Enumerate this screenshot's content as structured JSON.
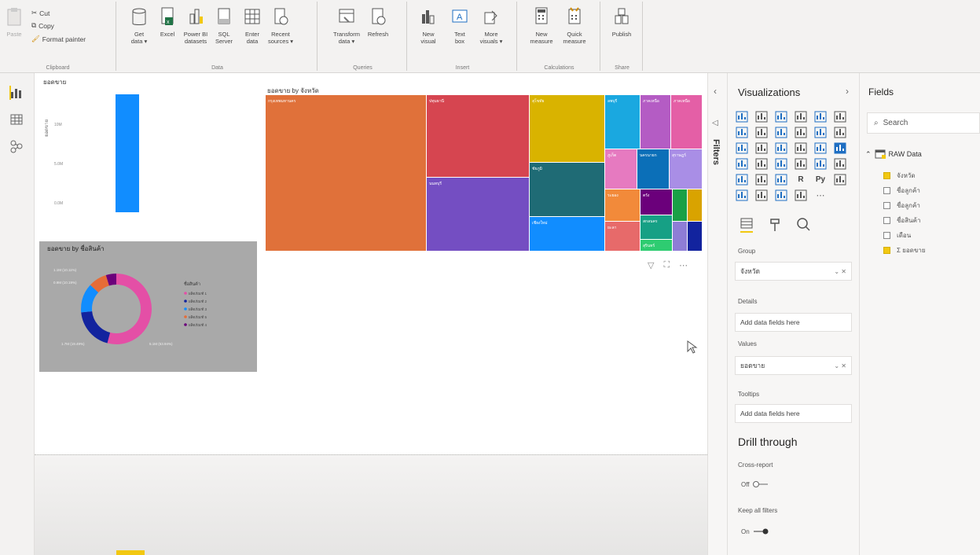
{
  "ribbon": {
    "clipboard": {
      "paste": "Paste",
      "cut": "Cut",
      "copy": "Copy",
      "format_painter": "Format painter",
      "group": "Clipboard"
    },
    "data": {
      "get_data": "Get\ndata ▾",
      "excel": "Excel",
      "power_bi": "Power BI\ndatasets",
      "sql": "SQL\nServer",
      "enter_data": "Enter\ndata",
      "recent": "Recent\nsources ▾",
      "group": "Data"
    },
    "queries": {
      "transform": "Transform\ndata ▾",
      "refresh": "Refresh",
      "group": "Queries"
    },
    "insert": {
      "new_visual": "New\nvisual",
      "text_box": "Text\nbox",
      "more_visuals": "More\nvisuals ▾",
      "group": "Insert"
    },
    "calculations": {
      "new_measure": "New\nmeasure",
      "quick_measure": "Quick\nmeasure",
      "group": "Calculations"
    },
    "share": {
      "publish": "Publish",
      "group": "Share"
    }
  },
  "visuals": {
    "bar": {
      "title": "ยอดขาย",
      "ylabel": "ยอดขาย",
      "ticks": [
        "10M",
        "5.0M",
        "0.0M"
      ]
    },
    "donut": {
      "title": "ยอดขาย by ชื่อสินค้า",
      "legend_title": "ชื่อสินค้า",
      "legend": [
        "ผลิตภัณฑ์ 1",
        "ผลิตภัณฑ์ 2",
        "ผลิตภัณฑ์ 3",
        "ผลิตภัณฑ์ 5",
        "ผลิตภัณฑ์ 4"
      ],
      "labels": [
        "1.1M (10.11%)",
        "0.9M (10.19%)",
        "1.7M (19.49%)",
        "5.1M (53.94%)"
      ]
    },
    "treemap": {
      "title": "ยอดขาย by จังหวัด",
      "cells": [
        "กรุงเทพมหานคร",
        "ปทุมธานี",
        "นนทบุรี",
        "สุโขทัย",
        "ชัยภูมิ",
        "เชียงใหม่",
        "ลพบุรี",
        "ภาคเหนือ",
        "ภาคเหนือ",
        "ภูเก็ต",
        "นครนายก",
        "สุราษฎร์",
        "ระยอง",
        "ตรัง",
        "ยะลา",
        "สกลนคร",
        "สุรินทร์",
        "ชลบุรี"
      ]
    }
  },
  "filters": {
    "label": "Filters"
  },
  "viz_pane": {
    "title": "Visualizations",
    "group_label": "Group",
    "group_value": "จังหวัด",
    "details_label": "Details",
    "details_placeholder": "Add data fields here",
    "values_label": "Values",
    "values_value": "ยอดขาย",
    "tooltips_label": "Tooltips",
    "tooltips_placeholder": "Add data fields here",
    "drill_title": "Drill through",
    "cross_report_label": "Cross-report",
    "cross_report_state": "Off",
    "keep_filters_label": "Keep all filters",
    "keep_filters_state": "On"
  },
  "fields_pane": {
    "title": "Fields",
    "search_placeholder": "Search",
    "table": "RAW Data",
    "fields": [
      {
        "name": "จังหวัด",
        "checked": true
      },
      {
        "name": "ชื่อลูกค้า",
        "checked": false
      },
      {
        "name": "ชื่อลูกค้า",
        "checked": false
      },
      {
        "name": "ชื่อสินค้า",
        "checked": false
      },
      {
        "name": "เดือน",
        "checked": false
      },
      {
        "name": "Σ ยอดขาย",
        "checked": true
      }
    ]
  },
  "colors": {
    "accent": "#f2c811",
    "bar": "#118dff",
    "donut_pink": "#e44fa6",
    "donut_navy": "#12239e",
    "donut_blue": "#118dff",
    "donut_orange": "#e66c37",
    "donut_purple": "#6b007b"
  }
}
